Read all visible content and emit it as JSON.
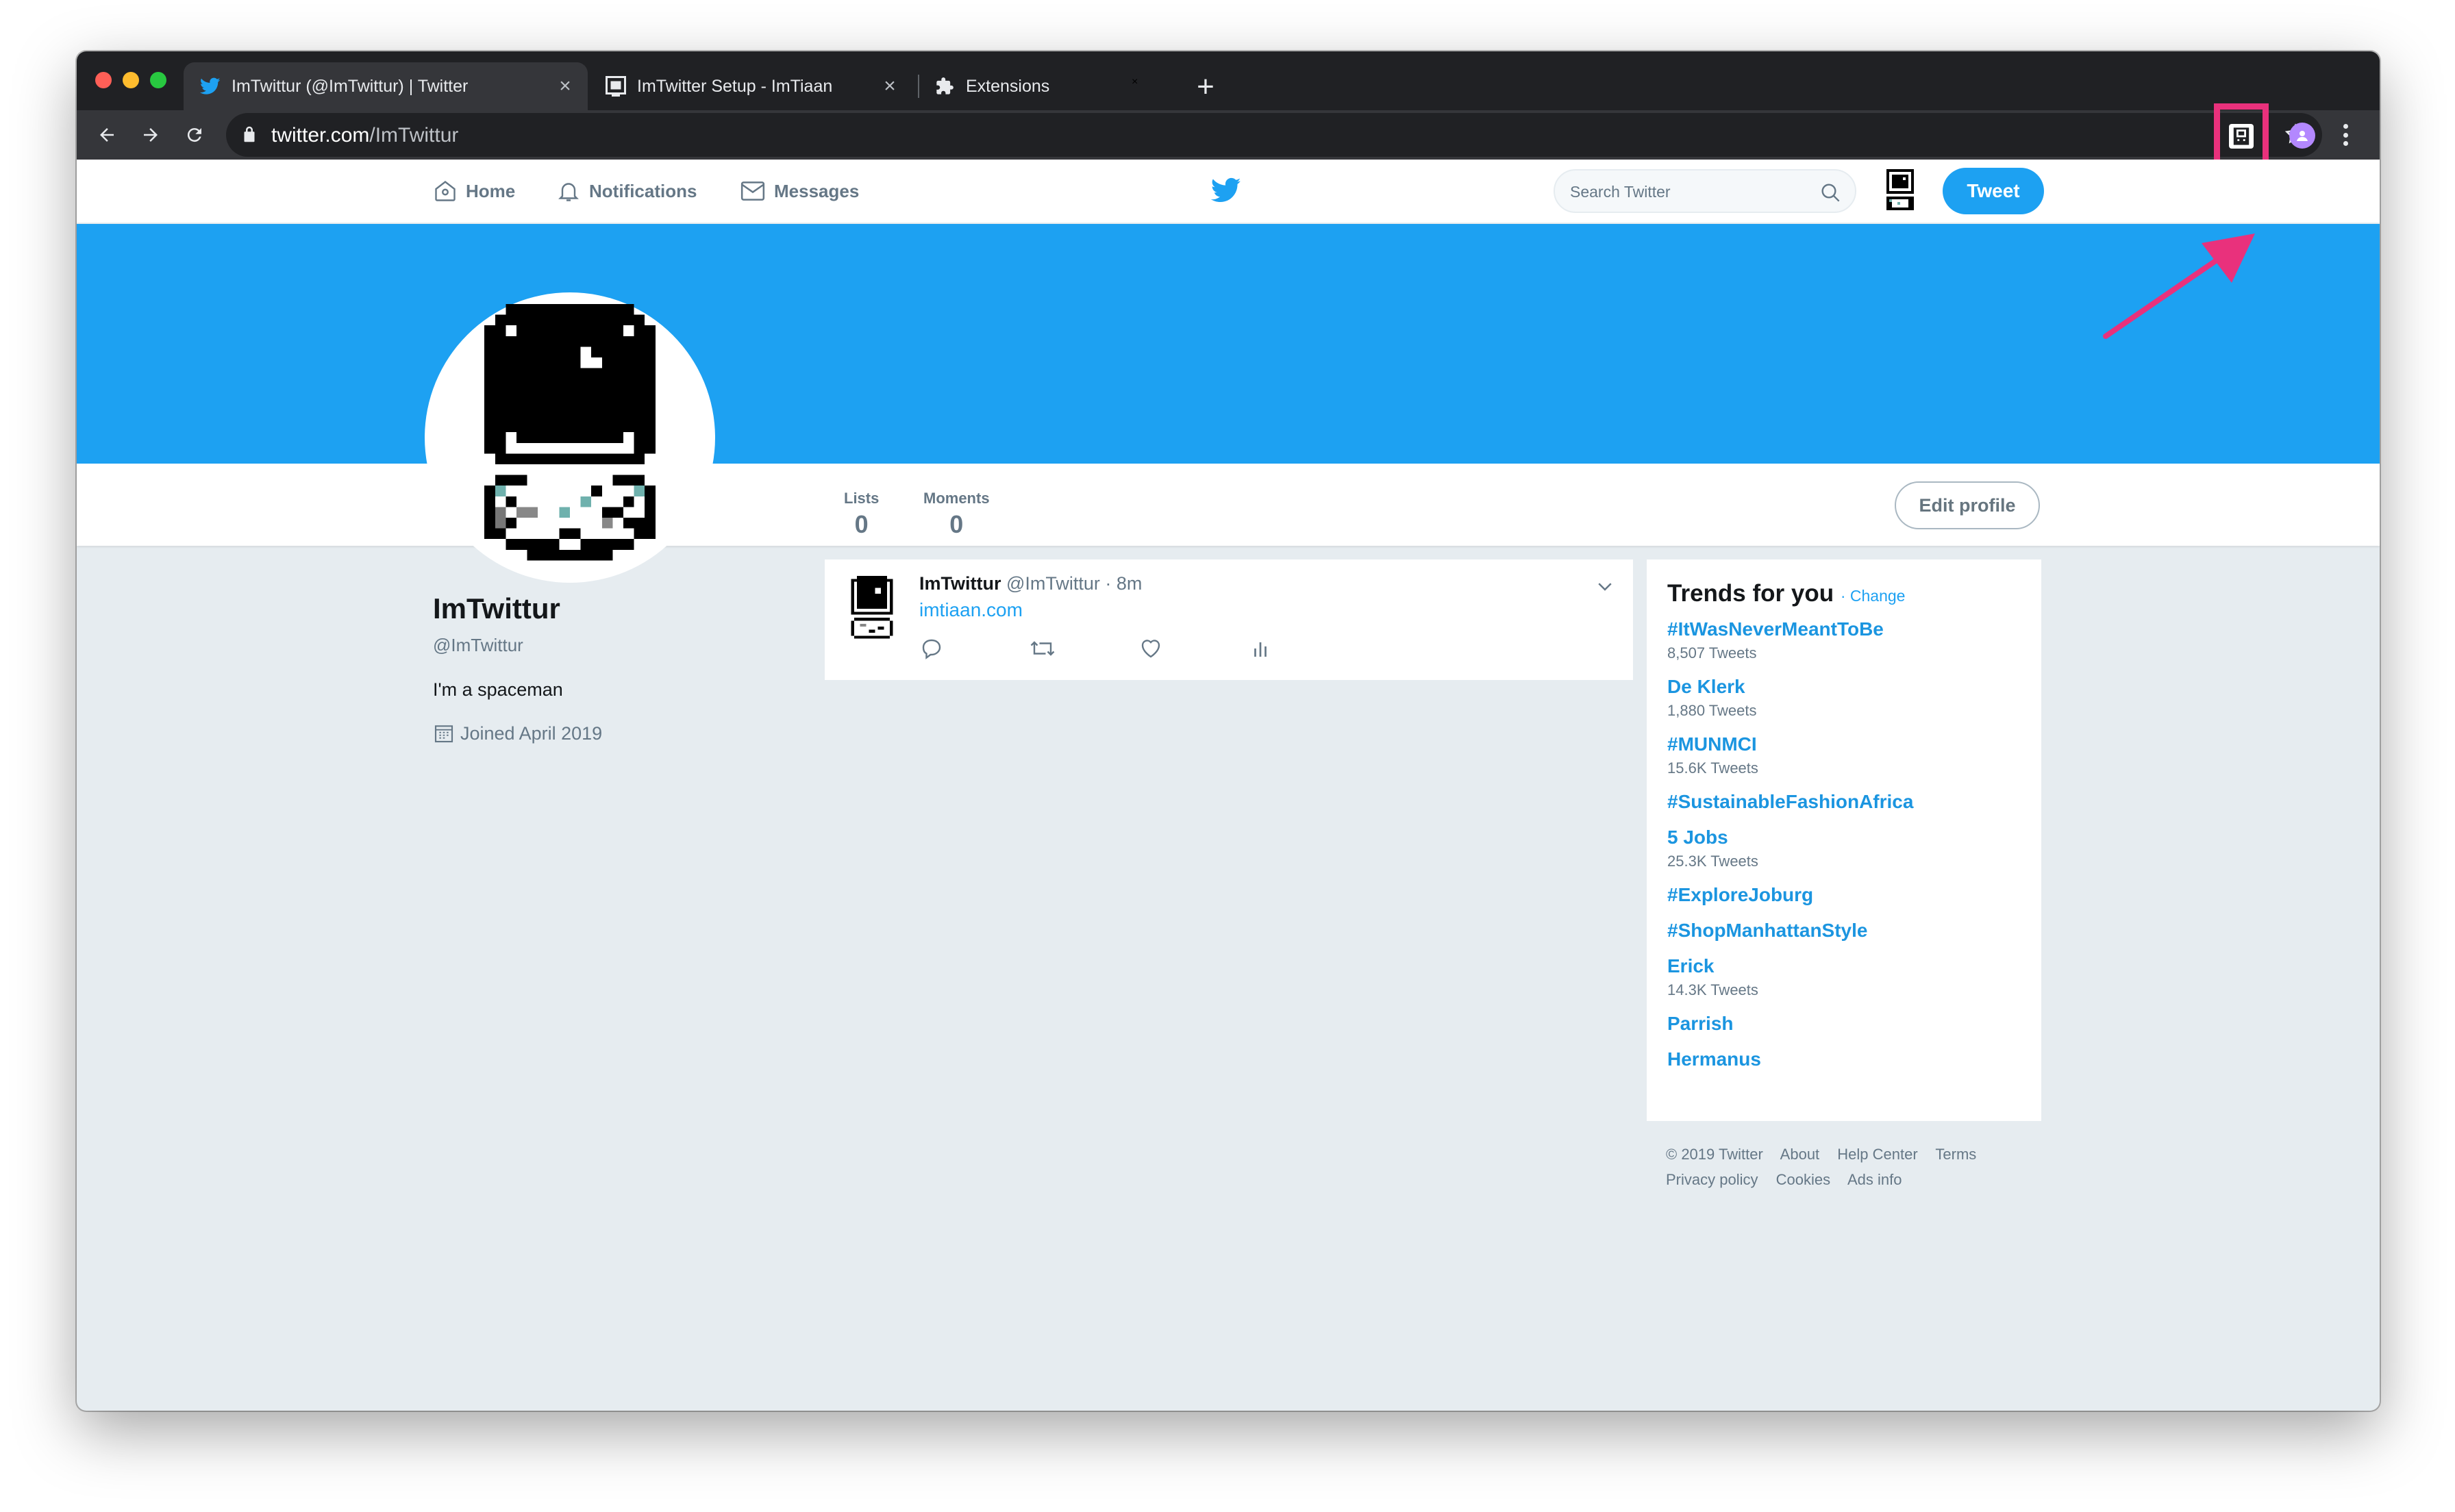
{
  "browser": {
    "tabs": [
      {
        "title": "ImTwittur (@ImTwittur) | Twitter",
        "icon": "twitter-bird-icon"
      },
      {
        "title": "ImTwitter Setup - ImTiaan",
        "icon": "astronaut-favicon-icon"
      },
      {
        "title": "Extensions",
        "icon": "puzzle-icon"
      }
    ],
    "new_tab": "+",
    "close_glyph": "×",
    "url_host": "twitter.com",
    "url_path": "/ImTwittur"
  },
  "twitter": {
    "nav": {
      "home": "Home",
      "notifications": "Notifications",
      "messages": "Messages",
      "search_placeholder": "Search Twitter",
      "tweet_button": "Tweet"
    },
    "stats": [
      {
        "label": "Lists",
        "value": "0"
      },
      {
        "label": "Moments",
        "value": "0"
      }
    ],
    "edit_profile": "Edit profile",
    "profile": {
      "name": "ImTwittur",
      "handle": "@ImTwittur",
      "bio": "I'm a spaceman",
      "joined": "Joined April 2019"
    },
    "tweet": {
      "name": "ImTwittur",
      "meta": "@ImTwittur · 8m",
      "link": "imtiaan.com"
    },
    "trends": {
      "title": "Trends for you",
      "change": "· Change",
      "items": [
        {
          "name": "#ItWasNeverMeantToBe",
          "count": "8,507 Tweets"
        },
        {
          "name": "De Klerk",
          "count": "1,880 Tweets"
        },
        {
          "name": "#MUNMCI",
          "count": "15.6K Tweets"
        },
        {
          "name": "#SustainableFashionAfrica",
          "count": ""
        },
        {
          "name": "5 Jobs",
          "count": "25.3K Tweets"
        },
        {
          "name": "#ExploreJoburg",
          "count": ""
        },
        {
          "name": "#ShopManhattanStyle",
          "count": ""
        },
        {
          "name": "Erick",
          "count": "14.3K Tweets"
        },
        {
          "name": "Parrish",
          "count": ""
        },
        {
          "name": "Hermanus",
          "count": ""
        }
      ]
    },
    "footer": {
      "row1": [
        "© 2019 Twitter",
        "About",
        "Help Center",
        "Terms"
      ],
      "row2": [
        "Privacy policy",
        "Cookies",
        "Ads info"
      ]
    }
  },
  "colors": {
    "twitter_blue": "#1da1f2",
    "highlight": "#e9317c",
    "background": "#e6ecf0"
  }
}
